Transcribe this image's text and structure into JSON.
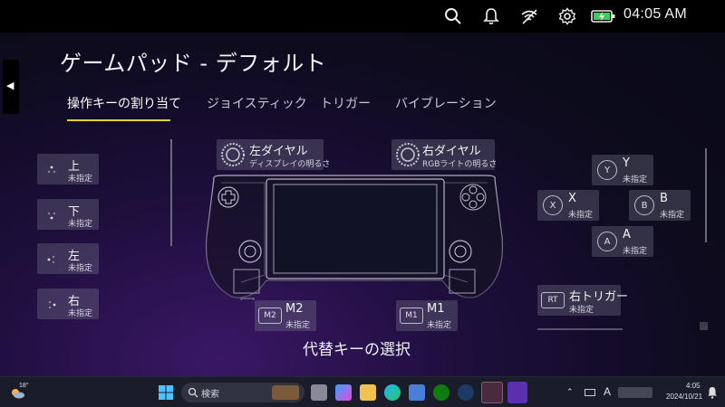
{
  "statusbar": {
    "time": "04:05 AM",
    "icons": [
      "search-icon",
      "bell-icon",
      "wifi-off-icon",
      "gear-icon",
      "battery-charging-icon"
    ],
    "battery_color": "#34d058"
  },
  "page": {
    "title": "ゲームパッド - デフォルト",
    "collapse_glyph": "◀"
  },
  "tabs": [
    {
      "label": "操作キーの割り当て",
      "active": true
    },
    {
      "label": "ジョイスティック",
      "active": false
    },
    {
      "label": "トリガー",
      "active": false
    },
    {
      "label": "バイブレーション",
      "active": false
    }
  ],
  "accent_color": "#e6d12a",
  "left_buttons": [
    {
      "label": "上",
      "value": "未指定"
    },
    {
      "label": "下",
      "value": "未指定"
    },
    {
      "label": "左",
      "value": "未指定"
    },
    {
      "label": "右",
      "value": "未指定"
    }
  ],
  "dials": {
    "left": {
      "label": "左ダイヤル",
      "value": "ディスプレイの明るさ"
    },
    "right": {
      "label": "右ダイヤル",
      "value": "RGBライトの明るさ"
    }
  },
  "face_buttons": {
    "y": {
      "glyph": "Y",
      "label": "Y",
      "value": "未指定"
    },
    "x": {
      "glyph": "X",
      "label": "X",
      "value": "未指定"
    },
    "b": {
      "glyph": "B",
      "label": "B",
      "value": "未指定"
    },
    "a": {
      "glyph": "A",
      "label": "A",
      "value": "未指定"
    }
  },
  "rear_buttons": {
    "m2": {
      "glyph": "M2",
      "label": "M2",
      "value": "未指定"
    },
    "m1": {
      "glyph": "M1",
      "label": "M1",
      "value": "未指定"
    }
  },
  "trigger": {
    "glyph": "RT",
    "label": "右トリガー",
    "value": "未指定"
  },
  "alt_key_label": "代替キーの選択",
  "taskbar": {
    "weather_temp": "18°",
    "search_placeholder": "検索",
    "tray_input": "A",
    "tray_time": "4:05",
    "tray_date": "2024/10/21"
  }
}
